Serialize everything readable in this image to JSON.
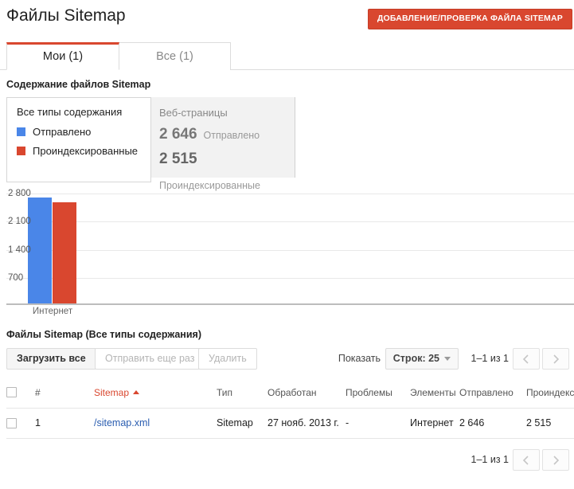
{
  "header": {
    "title": "Файлы Sitemap",
    "add_button": "ДОБАВЛЕНИЕ/ПРОВЕРКА ФАЙЛА SITEMAP"
  },
  "tabs": [
    {
      "label": "Мои (1)",
      "active": true
    },
    {
      "label": "Все (1)",
      "active": false
    }
  ],
  "content_section": {
    "title": "Содержание файлов Sitemap",
    "legend": {
      "title": "Все типы содержания",
      "items": [
        {
          "label": "Отправлено",
          "color": "#4a86e8"
        },
        {
          "label": "Проиндексированные",
          "color": "#d9472f"
        }
      ]
    },
    "stat_card": {
      "heading": "Веб-страницы",
      "submitted_value": "2 646",
      "submitted_label": "Отправлено",
      "indexed_value": "2 515",
      "indexed_label": "Проиндексированные"
    }
  },
  "chart_data": {
    "type": "bar",
    "title": "Содержание файлов Sitemap",
    "categories": [
      "Интернет"
    ],
    "series": [
      {
        "name": "Отправлено",
        "values": [
          2646
        ],
        "color": "#4a86e8"
      },
      {
        "name": "Проиндексированные",
        "values": [
          2515
        ],
        "color": "#d9472f"
      }
    ],
    "yticks": [
      "700",
      "1 400",
      "2 100",
      "2 800"
    ],
    "ytick_values": [
      700,
      1400,
      2100,
      2800
    ],
    "ylim": [
      0,
      2900
    ],
    "xlabel": "",
    "ylabel": "",
    "grid": true,
    "legend_position": "left-panel"
  },
  "table_section": {
    "title": "Файлы Sitemap (Все типы содержания)",
    "toolbar": {
      "download_all": "Загрузить все",
      "resubmit": "Отправить еще раз",
      "delete": "Удалить",
      "show_label": "Показать",
      "rows_select": "Строк: 25",
      "page_range": "1–1 из 1",
      "prev_icon": "chevron-left-icon",
      "next_icon": "chevron-right-icon"
    },
    "columns": [
      "#",
      "Sitemap",
      "Тип",
      "Обработан",
      "Проблемы",
      "Элементы",
      "Отправлено",
      "Проиндексированные"
    ],
    "sorted_column": "Sitemap",
    "sort_direction": "asc",
    "rows": [
      {
        "num": "1",
        "name": "/sitemap.xml",
        "type": "Sitemap",
        "processed": "27 нояб. 2013 г.",
        "problems": "-",
        "elements": "Интернет",
        "submitted": "2 646",
        "indexed": "2 515"
      }
    ],
    "bottom_page_range": "1–1 из 1"
  }
}
